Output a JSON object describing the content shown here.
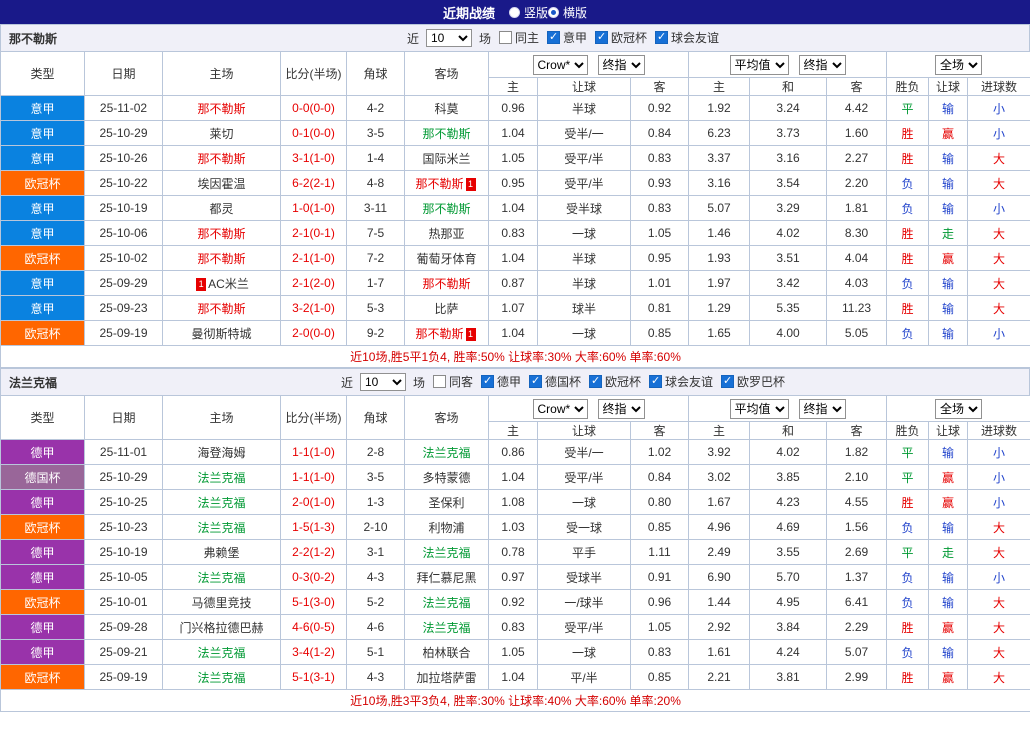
{
  "title_bar": {
    "title": "近期战绩",
    "radios": [
      {
        "label": "竖版",
        "selected": false
      },
      {
        "label": "横版",
        "selected": true
      }
    ]
  },
  "columns": [
    "类型",
    "日期",
    "主场",
    "比分(半场)",
    "角球",
    "客场",
    "主",
    "让球",
    "客",
    "主",
    "和",
    "客",
    "胜负",
    "让球",
    "进球数"
  ],
  "dropdowns": [
    "Crow*",
    "终指",
    "平均值",
    "终指",
    "全场"
  ],
  "near_label": "近",
  "games_label": "场",
  "match_count": "10",
  "league_colors": {
    "意甲": "#0a82e0",
    "欧冠杯": "#ff6600",
    "德甲": "#9933aa",
    "德国杯": "#996699"
  },
  "result_colors": {
    "胜": "#e60000",
    "赢": "#e60000",
    "大": "#e60000",
    "负": "#2244cc",
    "输": "#2244cc",
    "小": "#2244cc",
    "平": "#009933",
    "走": "#009933"
  },
  "team_colors": {
    "red": "#e60000",
    "green": "#009933",
    "black": "#333333"
  },
  "sections": [
    {
      "team": "那不勒斯",
      "filters": [
        {
          "label": "同主",
          "checked": false
        },
        {
          "label": "意甲",
          "checked": true
        },
        {
          "label": "欧冠杯",
          "checked": true
        },
        {
          "label": "球会友谊",
          "checked": true
        }
      ],
      "summary": "近10场,胜5平1负4, 胜率:50%  让球率:30%  大率:60%  单率:60%",
      "rows": [
        {
          "league": "意甲",
          "date": "25-11-02",
          "home": {
            "name": "那不勒斯",
            "color": "red"
          },
          "score": "0-0(0-0)",
          "corner": "4-2",
          "away": {
            "name": "科莫",
            "color": "black"
          },
          "ah": [
            "0.96",
            "半球",
            "0.92"
          ],
          "euro": [
            "1.92",
            "3.24",
            "4.42"
          ],
          "result": [
            "平",
            "输",
            "小"
          ]
        },
        {
          "league": "意甲",
          "date": "25-10-29",
          "home": {
            "name": "莱切",
            "color": "black"
          },
          "score": "0-1(0-0)",
          "corner": "3-5",
          "away": {
            "name": "那不勒斯",
            "color": "green"
          },
          "ah": [
            "1.04",
            "受半/一",
            "0.84"
          ],
          "euro": [
            "6.23",
            "3.73",
            "1.60"
          ],
          "result": [
            "胜",
            "赢",
            "小"
          ]
        },
        {
          "league": "意甲",
          "date": "25-10-26",
          "home": {
            "name": "那不勒斯",
            "color": "red"
          },
          "score": "3-1(1-0)",
          "corner": "1-4",
          "away": {
            "name": "国际米兰",
            "color": "black"
          },
          "ah": [
            "1.05",
            "受平/半",
            "0.83"
          ],
          "euro": [
            "3.37",
            "3.16",
            "2.27"
          ],
          "result": [
            "胜",
            "输",
            "大"
          ]
        },
        {
          "league": "欧冠杯",
          "date": "25-10-22",
          "home": {
            "name": "埃因霍温",
            "color": "black"
          },
          "score": "6-2(2-1)",
          "corner": "4-8",
          "away": {
            "name": "那不勒斯",
            "color": "red",
            "badge_post": "1"
          },
          "ah": [
            "0.95",
            "受平/半",
            "0.93"
          ],
          "euro": [
            "3.16",
            "3.54",
            "2.20"
          ],
          "result": [
            "负",
            "输",
            "大"
          ]
        },
        {
          "league": "意甲",
          "date": "25-10-19",
          "home": {
            "name": "都灵",
            "color": "black"
          },
          "score": "1-0(1-0)",
          "corner": "3-11",
          "away": {
            "name": "那不勒斯",
            "color": "green"
          },
          "ah": [
            "1.04",
            "受半球",
            "0.83"
          ],
          "euro": [
            "5.07",
            "3.29",
            "1.81"
          ],
          "result": [
            "负",
            "输",
            "小"
          ]
        },
        {
          "league": "意甲",
          "date": "25-10-06",
          "home": {
            "name": "那不勒斯",
            "color": "red"
          },
          "score": "2-1(0-1)",
          "corner": "7-5",
          "away": {
            "name": "热那亚",
            "color": "black"
          },
          "ah": [
            "0.83",
            "一球",
            "1.05"
          ],
          "euro": [
            "1.46",
            "4.02",
            "8.30"
          ],
          "result": [
            "胜",
            "走",
            "大"
          ]
        },
        {
          "league": "欧冠杯",
          "date": "25-10-02",
          "home": {
            "name": "那不勒斯",
            "color": "red"
          },
          "score": "2-1(1-0)",
          "corner": "7-2",
          "away": {
            "name": "葡萄牙体育",
            "color": "black"
          },
          "ah": [
            "1.04",
            "半球",
            "0.95"
          ],
          "euro": [
            "1.93",
            "3.51",
            "4.04"
          ],
          "result": [
            "胜",
            "赢",
            "大"
          ]
        },
        {
          "league": "意甲",
          "date": "25-09-29",
          "home": {
            "name": "AC米兰",
            "color": "black",
            "badge_pre": "1"
          },
          "score": "2-1(2-0)",
          "corner": "1-7",
          "away": {
            "name": "那不勒斯",
            "color": "red"
          },
          "ah": [
            "0.87",
            "半球",
            "1.01"
          ],
          "euro": [
            "1.97",
            "3.42",
            "4.03"
          ],
          "result": [
            "负",
            "输",
            "大"
          ]
        },
        {
          "league": "意甲",
          "date": "25-09-23",
          "home": {
            "name": "那不勒斯",
            "color": "red"
          },
          "score": "3-2(1-0)",
          "corner": "5-3",
          "away": {
            "name": "比萨",
            "color": "black"
          },
          "ah": [
            "1.07",
            "球半",
            "0.81"
          ],
          "euro": [
            "1.29",
            "5.35",
            "11.23"
          ],
          "result": [
            "胜",
            "输",
            "大"
          ]
        },
        {
          "league": "欧冠杯",
          "date": "25-09-19",
          "home": {
            "name": "曼彻斯特城",
            "color": "black"
          },
          "score": "2-0(0-0)",
          "corner": "9-2",
          "away": {
            "name": "那不勒斯",
            "color": "red",
            "badge_post": "1"
          },
          "ah": [
            "1.04",
            "一球",
            "0.85"
          ],
          "euro": [
            "1.65",
            "4.00",
            "5.05"
          ],
          "result": [
            "负",
            "输",
            "小"
          ]
        }
      ]
    },
    {
      "team": "法兰克福",
      "filters": [
        {
          "label": "同客",
          "checked": false
        },
        {
          "label": "德甲",
          "checked": true
        },
        {
          "label": "德国杯",
          "checked": true
        },
        {
          "label": "欧冠杯",
          "checked": true
        },
        {
          "label": "球会友谊",
          "checked": true
        },
        {
          "label": "欧罗巴杯",
          "checked": true
        }
      ],
      "summary": "近10场,胜3平3负4, 胜率:30%  让球率:40%  大率:60%  单率:20%",
      "rows": [
        {
          "league": "德甲",
          "date": "25-11-01",
          "home": {
            "name": "海登海姆",
            "color": "black"
          },
          "score": "1-1(1-0)",
          "corner": "2-8",
          "away": {
            "name": "法兰克福",
            "color": "green"
          },
          "ah": [
            "0.86",
            "受半/一",
            "1.02"
          ],
          "euro": [
            "3.92",
            "4.02",
            "1.82"
          ],
          "result": [
            "平",
            "输",
            "小"
          ]
        },
        {
          "league": "德国杯",
          "date": "25-10-29",
          "home": {
            "name": "法兰克福",
            "color": "green"
          },
          "score": "1-1(1-0)",
          "corner": "3-5",
          "away": {
            "name": "多特蒙德",
            "color": "black"
          },
          "ah": [
            "1.04",
            "受平/半",
            "0.84"
          ],
          "euro": [
            "3.02",
            "3.85",
            "2.10"
          ],
          "result": [
            "平",
            "赢",
            "小"
          ]
        },
        {
          "league": "德甲",
          "date": "25-10-25",
          "home": {
            "name": "法兰克福",
            "color": "green"
          },
          "score": "2-0(1-0)",
          "corner": "1-3",
          "away": {
            "name": "圣保利",
            "color": "black"
          },
          "ah": [
            "1.08",
            "一球",
            "0.80"
          ],
          "euro": [
            "1.67",
            "4.23",
            "4.55"
          ],
          "result": [
            "胜",
            "赢",
            "小"
          ]
        },
        {
          "league": "欧冠杯",
          "date": "25-10-23",
          "home": {
            "name": "法兰克福",
            "color": "green"
          },
          "score": "1-5(1-3)",
          "corner": "2-10",
          "away": {
            "name": "利物浦",
            "color": "black"
          },
          "ah": [
            "1.03",
            "受一球",
            "0.85"
          ],
          "euro": [
            "4.96",
            "4.69",
            "1.56"
          ],
          "result": [
            "负",
            "输",
            "大"
          ]
        },
        {
          "league": "德甲",
          "date": "25-10-19",
          "home": {
            "name": "弗赖堡",
            "color": "black"
          },
          "score": "2-2(1-2)",
          "corner": "3-1",
          "away": {
            "name": "法兰克福",
            "color": "green"
          },
          "ah": [
            "0.78",
            "平手",
            "1.11"
          ],
          "euro": [
            "2.49",
            "3.55",
            "2.69"
          ],
          "result": [
            "平",
            "走",
            "大"
          ]
        },
        {
          "league": "德甲",
          "date": "25-10-05",
          "home": {
            "name": "法兰克福",
            "color": "green"
          },
          "score": "0-3(0-2)",
          "corner": "4-3",
          "away": {
            "name": "拜仁慕尼黑",
            "color": "black"
          },
          "ah": [
            "0.97",
            "受球半",
            "0.91"
          ],
          "euro": [
            "6.90",
            "5.70",
            "1.37"
          ],
          "result": [
            "负",
            "输",
            "小"
          ]
        },
        {
          "league": "欧冠杯",
          "date": "25-10-01",
          "home": {
            "name": "马德里竞技",
            "color": "black"
          },
          "score": "5-1(3-0)",
          "corner": "5-2",
          "away": {
            "name": "法兰克福",
            "color": "green"
          },
          "ah": [
            "0.92",
            "一/球半",
            "0.96"
          ],
          "euro": [
            "1.44",
            "4.95",
            "6.41"
          ],
          "result": [
            "负",
            "输",
            "大"
          ]
        },
        {
          "league": "德甲",
          "date": "25-09-28",
          "home": {
            "name": "门兴格拉德巴赫",
            "color": "black"
          },
          "score": "4-6(0-5)",
          "corner": "4-6",
          "away": {
            "name": "法兰克福",
            "color": "green"
          },
          "ah": [
            "0.83",
            "受平/半",
            "1.05"
          ],
          "euro": [
            "2.92",
            "3.84",
            "2.29"
          ],
          "result": [
            "胜",
            "赢",
            "大"
          ]
        },
        {
          "league": "德甲",
          "date": "25-09-21",
          "home": {
            "name": "法兰克福",
            "color": "green"
          },
          "score": "3-4(1-2)",
          "corner": "5-1",
          "away": {
            "name": "柏林联合",
            "color": "black"
          },
          "ah": [
            "1.05",
            "一球",
            "0.83"
          ],
          "euro": [
            "1.61",
            "4.24",
            "5.07"
          ],
          "result": [
            "负",
            "输",
            "大"
          ]
        },
        {
          "league": "欧冠杯",
          "date": "25-09-19",
          "home": {
            "name": "法兰克福",
            "color": "green"
          },
          "score": "5-1(3-1)",
          "corner": "4-3",
          "away": {
            "name": "加拉塔萨雷",
            "color": "black"
          },
          "ah": [
            "1.04",
            "平/半",
            "0.85"
          ],
          "euro": [
            "2.21",
            "3.81",
            "2.99"
          ],
          "result": [
            "胜",
            "赢",
            "大"
          ]
        }
      ]
    }
  ]
}
